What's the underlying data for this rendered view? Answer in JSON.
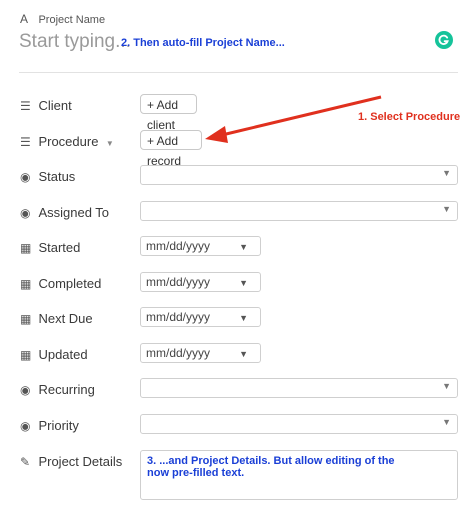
{
  "header": {
    "label": "Project Name",
    "placeholder": "Start typing...",
    "annotation_autofill": "2. Then auto-fill Project Name..."
  },
  "fields": {
    "client": {
      "label": "Client",
      "button": "+ Add client"
    },
    "procedure": {
      "label": "Procedure",
      "button": "+ Add record"
    },
    "status": {
      "label": "Status"
    },
    "assigned_to": {
      "label": "Assigned To"
    },
    "started": {
      "label": "Started",
      "placeholder": "mm/dd/yyyy"
    },
    "completed": {
      "label": "Completed",
      "placeholder": "mm/dd/yyyy"
    },
    "next_due": {
      "label": "Next Due",
      "placeholder": "mm/dd/yyyy"
    },
    "updated": {
      "label": "Updated",
      "placeholder": "mm/dd/yyyy"
    },
    "recurring": {
      "label": "Recurring"
    },
    "priority": {
      "label": "Priority"
    },
    "project_details": {
      "label": "Project Details",
      "annotation_line1": "3. ...and Project Details. But allow editing of the",
      "annotation_line2": "now pre-filled text."
    }
  },
  "annotations": {
    "select_procedure": "1. Select Procedure"
  },
  "colors": {
    "annotation_blue": "#1a3fd6",
    "annotation_red": "#e0301e",
    "grammarly_green": "#15c39a",
    "arrow_red": "#e0301e"
  },
  "icons": {
    "project_name": "text-a-icon",
    "client": "list-lines-icon",
    "procedure": "list-lines-icon",
    "status": "circle-dot-icon",
    "assigned_to": "circle-dot-icon",
    "date": "calendar-icon",
    "recurring": "circle-dot-icon",
    "priority": "circle-dot-icon",
    "project_details": "long-text-icon",
    "grammarly": "grammarly-icon"
  }
}
